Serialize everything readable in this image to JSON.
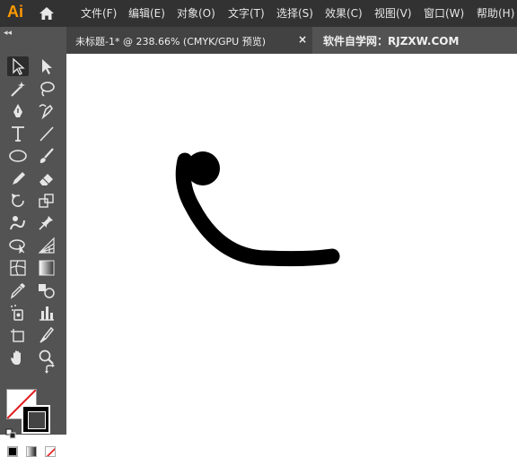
{
  "app": {
    "logo": "Ai"
  },
  "menu": {
    "items": [
      "文件(F)",
      "编辑(E)",
      "对象(O)",
      "文字(T)",
      "选择(S)",
      "效果(C)",
      "视图(V)",
      "窗口(W)",
      "帮助(H)"
    ]
  },
  "toolbar": {
    "collapse_glyph": "◂◂"
  },
  "tabs": {
    "document_title": "未标题-1* @ 238.66% (CMYK/GPU 预览)",
    "close": "×",
    "watermark": "软件自学网：RJZXW.COM"
  },
  "colors": {
    "accent_logo": "#ff9a00",
    "menubar_bg": "#323232",
    "toolbar_bg": "#535353",
    "active_tab_bg": "#424242",
    "stroke_color": "#000000",
    "fill_none_slash": "#e01818"
  },
  "tool_icons": [
    "selection-tool",
    "direct-selection-tool",
    "magic-wand-tool",
    "lasso-tool",
    "pen-tool",
    "curvature-tool",
    "type-tool",
    "line-segment-tool",
    "ellipse-tool",
    "paintbrush-tool",
    "pencil-tool",
    "eraser-tool",
    "rotate-tool",
    "scale-tool",
    "warp-tool",
    "pin-tool",
    "shape-builder-tool",
    "perspective-grid-tool",
    "mesh-tool",
    "gradient-tool",
    "eyedropper-tool",
    "blend-tool",
    "symbol-sprayer-tool",
    "column-graph-tool",
    "artboard-tool",
    "slice-tool",
    "hand-tool",
    "zoom-tool"
  ]
}
